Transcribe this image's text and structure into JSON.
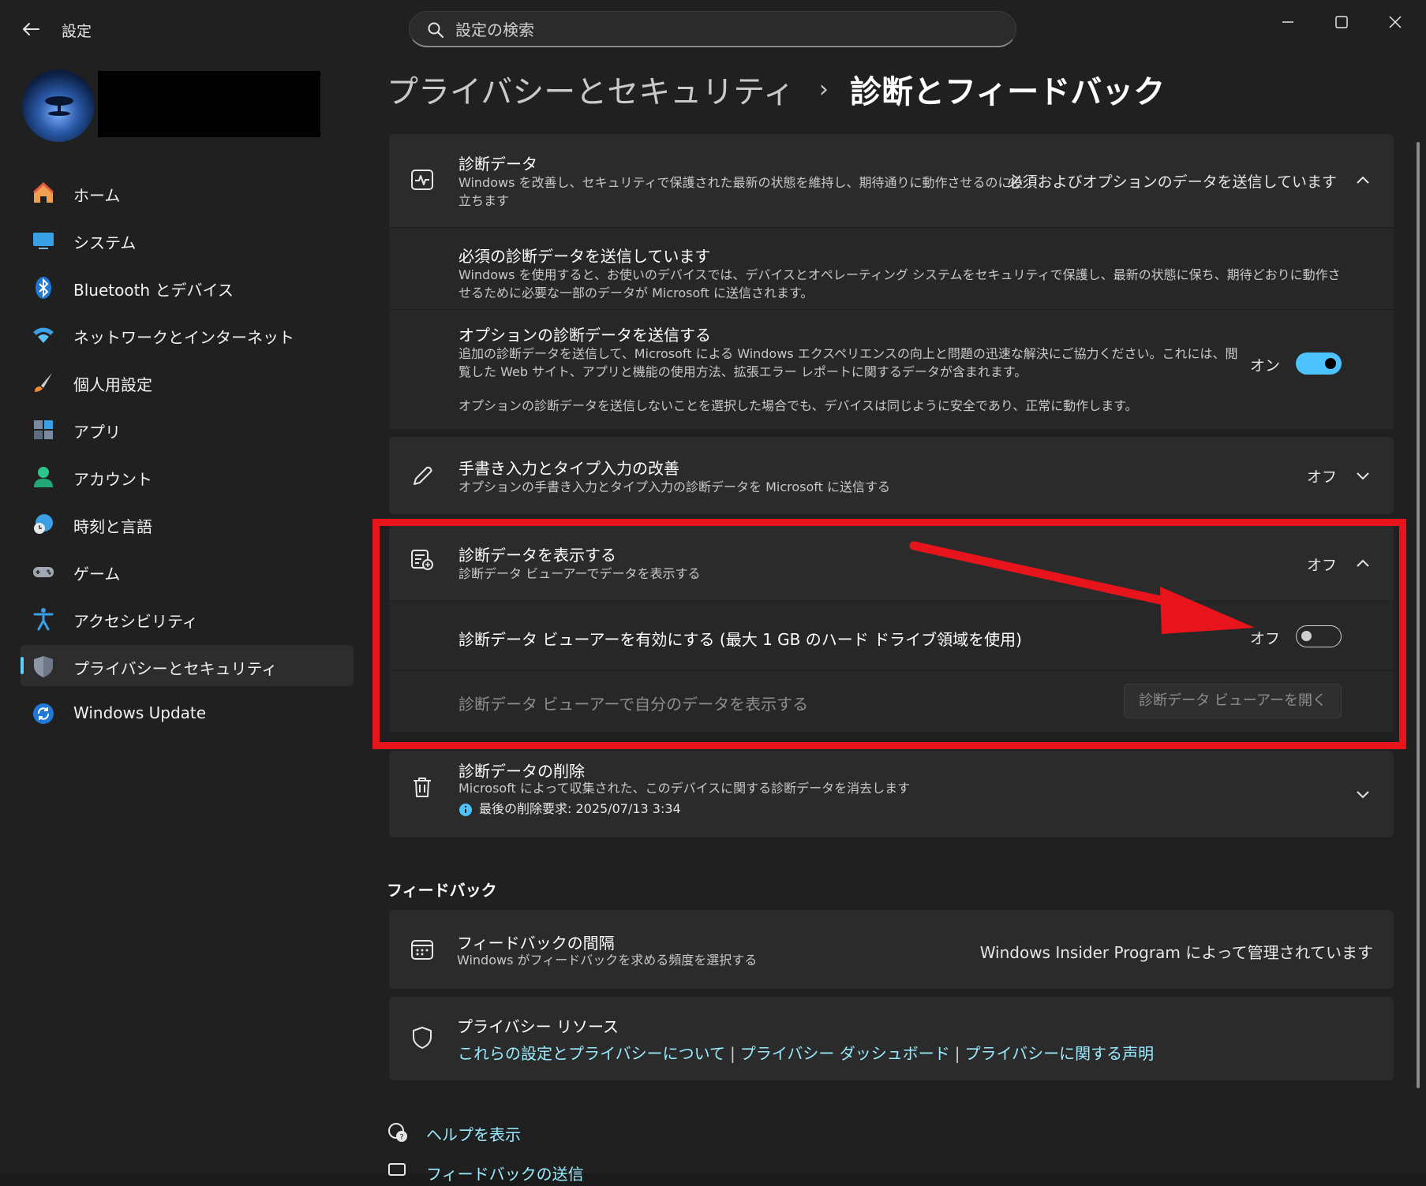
{
  "app": {
    "title": "設定"
  },
  "search": {
    "placeholder": "設定の検索"
  },
  "breadcrumb": {
    "parent": "プライバシーとセキュリティ",
    "separator": "›",
    "current": "診断とフィードバック"
  },
  "sidebar": {
    "items": [
      {
        "label": "ホーム",
        "icon": "home-icon"
      },
      {
        "label": "システム",
        "icon": "system-icon"
      },
      {
        "label": "Bluetooth とデバイス",
        "icon": "bluetooth-icon"
      },
      {
        "label": "ネットワークとインターネット",
        "icon": "wifi-icon"
      },
      {
        "label": "個人用設定",
        "icon": "brush-icon"
      },
      {
        "label": "アプリ",
        "icon": "apps-icon"
      },
      {
        "label": "アカウント",
        "icon": "account-icon"
      },
      {
        "label": "時刻と言語",
        "icon": "time-language-icon"
      },
      {
        "label": "ゲーム",
        "icon": "gamepad-icon"
      },
      {
        "label": "アクセシビリティ",
        "icon": "accessibility-icon"
      },
      {
        "label": "プライバシーとセキュリティ",
        "icon": "shield-icon",
        "active": true
      },
      {
        "label": "Windows Update",
        "icon": "update-icon"
      }
    ]
  },
  "diagnostic_data": {
    "title": "診断データ",
    "description": "Windows を改善し、セキュリティで保護された最新の状態を維持し、期待通りに動作させるのに役立ちます",
    "status": "必須およびオプションのデータを送信しています",
    "required": {
      "title": "必須の診断データを送信しています",
      "description": "Windows を使用すると、お使いのデバイスでは、デバイスとオペレーティング システムをセキュリティで保護し、最新の状態に保ち、期待どおりに動作させるために必要な一部のデータが Microsoft に送信されます。"
    },
    "optional": {
      "title": "オプションの診断データを送信する",
      "description": "追加の診断データを送信して、Microsoft による Windows エクスペリエンスの向上と問題の迅速な解決にご協力ください。これには、閲覧した Web サイト、アプリと機能の使用方法、拡張エラー レポートに関するデータが含まれます。",
      "note": "オプションの診断データを送信しないことを選択した場合でも、デバイスは同じように安全であり、正常に動作します。",
      "toggle_label": "オン"
    }
  },
  "inking": {
    "title": "手書き入力とタイプ入力の改善",
    "description": "オプションの手書き入力とタイプ入力の診断データを Microsoft に送信する",
    "status": "オフ"
  },
  "view_data": {
    "title": "診断データを表示する",
    "description": "診断データ ビューアーでデータを表示する",
    "status": "オフ",
    "enable_viewer": {
      "title": "診断データ ビューアーを有効にする (最大 1 GB のハード ドライブ領域を使用)",
      "toggle_label": "オフ"
    },
    "view_in_viewer": {
      "title": "診断データ ビューアーで自分のデータを表示する",
      "button": "診断データ ビューアーを開く"
    }
  },
  "delete_data": {
    "title": "診断データの削除",
    "description": "Microsoft によって収集された、このデバイスに関する診断データを消去します",
    "info": "最後の削除要求: 2025/07/13 3:34"
  },
  "feedback_section": {
    "heading": "フィードバック"
  },
  "feedback_frequency": {
    "title": "フィードバックの間隔",
    "description": "Windows がフィードバックを求める頻度を選択する",
    "status": "Windows Insider Program によって管理されています"
  },
  "privacy_resources": {
    "title": "プライバシー リソース",
    "links": [
      "これらの設定とプライバシーについて",
      "プライバシー ダッシュボード",
      "プライバシーに関する声明"
    ],
    "separator": "|"
  },
  "help": {
    "get_help": "ヘルプを表示",
    "send_feedback": "フィードバックの送信"
  },
  "colors": {
    "accent": "#4cc2ff",
    "link": "#99ebff",
    "annotation": "#e8141c",
    "background": "#202020",
    "card": "#2b2b2b"
  }
}
